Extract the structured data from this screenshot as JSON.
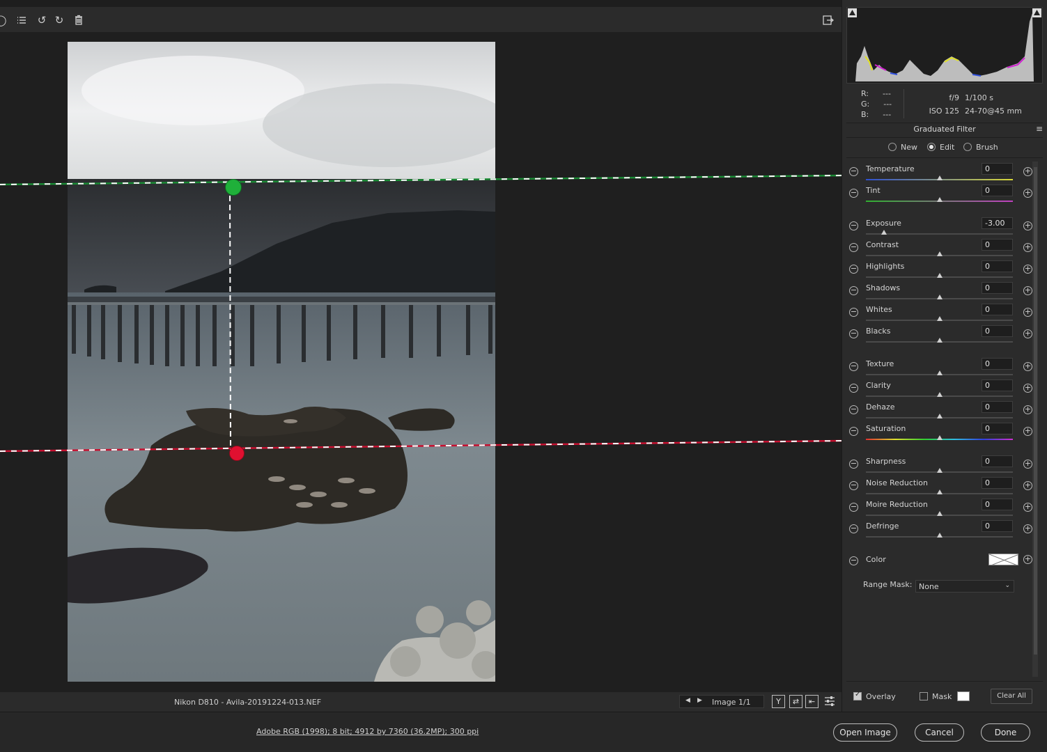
{
  "toolbar": {
    "icons": [
      "list-icon",
      "rotate-left-icon",
      "rotate-right-icon",
      "trash-icon",
      "export-icon"
    ]
  },
  "status": {
    "filename": "Nikon D810  -  Avila-20191224-013.NEF",
    "image_count": "Image 1/1",
    "btn_y": "Y",
    "btn_swap": "⇄",
    "btn_copy": "⇤"
  },
  "histogram": {
    "r_label": "R:",
    "r_value": "---",
    "g_label": "G:",
    "g_value": "---",
    "b_label": "B:",
    "b_value": "---",
    "aperture": "f/9",
    "shutter": "1/100 s",
    "iso": "ISO 125",
    "lens": "24-70@45 mm"
  },
  "panel": {
    "title": "Graduated Filter",
    "modes": [
      {
        "label": "New",
        "selected": false
      },
      {
        "label": "Edit",
        "selected": true
      },
      {
        "label": "Brush",
        "selected": false
      }
    ],
    "sliders": [
      {
        "label": "Temperature",
        "value": "0",
        "position": 0.5
      },
      {
        "label": "Tint",
        "value": "0",
        "position": 0.5
      },
      {
        "label": "Exposure",
        "value": "-3.00",
        "position": 0.125
      },
      {
        "label": "Contrast",
        "value": "0",
        "position": 0.5
      },
      {
        "label": "Highlights",
        "value": "0",
        "position": 0.5
      },
      {
        "label": "Shadows",
        "value": "0",
        "position": 0.5
      },
      {
        "label": "Whites",
        "value": "0",
        "position": 0.5
      },
      {
        "label": "Blacks",
        "value": "0",
        "position": 0.5
      },
      {
        "label": "Texture",
        "value": "0",
        "position": 0.5
      },
      {
        "label": "Clarity",
        "value": "0",
        "position": 0.5
      },
      {
        "label": "Dehaze",
        "value": "0",
        "position": 0.5
      },
      {
        "label": "Saturation",
        "value": "0",
        "position": 0.5
      },
      {
        "label": "Sharpness",
        "value": "0",
        "position": 0.5
      },
      {
        "label": "Noise Reduction",
        "value": "0",
        "position": 0.5
      },
      {
        "label": "Moire Reduction",
        "value": "0",
        "position": 0.5
      },
      {
        "label": "Defringe",
        "value": "0",
        "position": 0.5
      }
    ],
    "color_label": "Color",
    "range_mask_label": "Range Mask:",
    "range_mask_value": "None",
    "overlay_label": "Overlay",
    "overlay_checked": true,
    "mask_label": "Mask",
    "mask_checked": false,
    "clear_all": "Clear All"
  },
  "footer": {
    "file_info": "Adobe RGB (1998); 8 bit; 4912 by 7360 (36.2MP); 300 ppi",
    "open_image": "Open Image",
    "cancel": "Cancel",
    "done": "Done"
  },
  "colors": {
    "start_pin": "#1fb03a",
    "end_pin": "#e01030"
  }
}
